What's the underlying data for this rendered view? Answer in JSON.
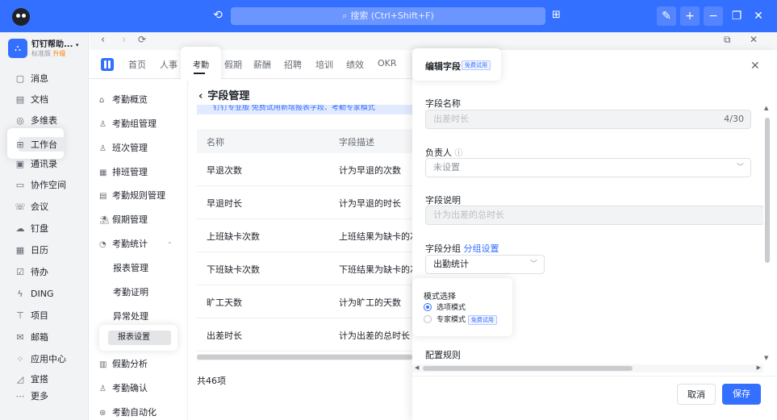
{
  "colors": {
    "accent": "#3370ff",
    "titlebar": "#3370ff"
  },
  "titlebar": {
    "search_placeholder": "搜索 (Ctrl+Shift+F)",
    "icons": [
      "history-icon",
      "qrcode-icon",
      "wand-icon",
      "plus-icon",
      "minimize-icon",
      "restore-icon",
      "close-icon"
    ]
  },
  "org": {
    "name": "钉钉帮助...",
    "edition": "标准版",
    "upgrade": "升级"
  },
  "leftnav": {
    "items": [
      {
        "label": "消息",
        "icon": "message-icon"
      },
      {
        "label": "文档",
        "icon": "document-icon"
      },
      {
        "label": "多维表",
        "icon": "table-icon"
      },
      {
        "label": "工作台",
        "icon": "workbench-icon"
      },
      {
        "label": "通讯录",
        "icon": "contacts-icon"
      },
      {
        "label": "协作空间",
        "icon": "space-icon"
      },
      {
        "label": "会议",
        "icon": "meeting-icon"
      },
      {
        "label": "钉盘",
        "icon": "drive-icon"
      },
      {
        "label": "日历",
        "icon": "calendar-icon"
      },
      {
        "label": "待办",
        "icon": "todo-icon"
      },
      {
        "label": "DING",
        "icon": "ding-icon"
      },
      {
        "label": "项目",
        "icon": "project-icon"
      },
      {
        "label": "邮箱",
        "icon": "mail-icon"
      },
      {
        "label": "应用中心",
        "icon": "apps-icon"
      },
      {
        "label": "宜搭",
        "icon": "yida-icon"
      },
      {
        "label": "更多",
        "icon": "more-icon"
      }
    ]
  },
  "tabs": {
    "items": [
      "首页",
      "人事",
      "考勤",
      "假期",
      "薪酬",
      "招聘",
      "培训",
      "绩效",
      "OKR"
    ],
    "active": "考勤"
  },
  "subnav": {
    "items": [
      {
        "label": "考勤概览",
        "icon": "home-icon"
      },
      {
        "label": "考勤组管理",
        "icon": "group-icon"
      },
      {
        "label": "班次管理",
        "icon": "shift-icon"
      },
      {
        "label": "排班管理",
        "icon": "schedule-icon"
      },
      {
        "label": "考勤规则管理",
        "icon": "rules-icon"
      },
      {
        "label": "假期管理",
        "icon": "holiday-icon"
      },
      {
        "label": "考勤统计",
        "icon": "stats-icon"
      }
    ],
    "children": [
      "报表管理",
      "考勤证明",
      "异常处理",
      "报表设置"
    ],
    "after": [
      {
        "label": "假勤分析",
        "icon": "analysis-icon"
      },
      {
        "label": "考勤确认",
        "icon": "confirm-icon"
      },
      {
        "label": "考勤自动化",
        "icon": "automation-icon"
      }
    ]
  },
  "main": {
    "title": "字段管理",
    "promo": "钉钉专业版   免费试用新增报表字段、考勤专家模式",
    "columns": [
      "名称",
      "字段描述"
    ],
    "rows": [
      [
        "早退次数",
        "计为早退的次数"
      ],
      [
        "早退时长",
        "计为早退的时长"
      ],
      [
        "上班缺卡次数",
        "上班结果为缺卡的次数"
      ],
      [
        "下班缺卡次数",
        "下班结果为缺卡的次数"
      ],
      [
        "旷工天数",
        "计为旷工的天数"
      ],
      [
        "出差时长",
        "计为出差的总时长"
      ]
    ],
    "total": "共46项"
  },
  "panel": {
    "title": "编辑字段",
    "trial_badge": "免费试用",
    "field_name_label": "字段名称",
    "field_name_value": "出差时长",
    "field_name_count": "4/30",
    "owner_label": "负责人",
    "owner_placeholder": "未设置",
    "desc_label": "字段说明",
    "desc_value": "计为出差的总时长",
    "group_label": "字段分组",
    "group_link": "分组设置",
    "group_value": "出勤统计",
    "mode_label": "模式选择",
    "mode_options": [
      "选项模式",
      "专家模式"
    ],
    "mode_selected": "选项模式",
    "config_label": "配置规则",
    "cancel": "取消",
    "save": "保存"
  }
}
